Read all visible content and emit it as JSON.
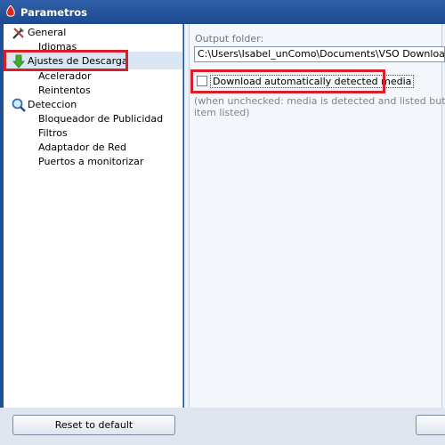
{
  "window": {
    "title": "Parametros"
  },
  "tree": {
    "general": {
      "label": "General",
      "children": [
        "Idiomas"
      ]
    },
    "descarga": {
      "label": "Ajustes de Descarga",
      "children": [
        "Acelerador",
        "Reintentos"
      ]
    },
    "deteccion": {
      "label": "Deteccion",
      "children": [
        "Bloqueador de Publicidad",
        "Filtros",
        "Adaptador de Red",
        "Puertos a monitorizar"
      ]
    }
  },
  "settings": {
    "output_folder_label": "Output folder:",
    "output_folder_value": "C:\\Users\\Isabel_unComo\\Documents\\VSO Downloader\\",
    "auto_download_label": "Download automatically detected media",
    "auto_download_checked": false,
    "description_line1": "(when unchecked: media is detected and listed but only downl",
    "description_line2": "item listed)"
  },
  "footer": {
    "reset_label": "Reset to default"
  },
  "colors": {
    "highlight": "#d81f2a",
    "titlebar": "#1d4a8f"
  }
}
